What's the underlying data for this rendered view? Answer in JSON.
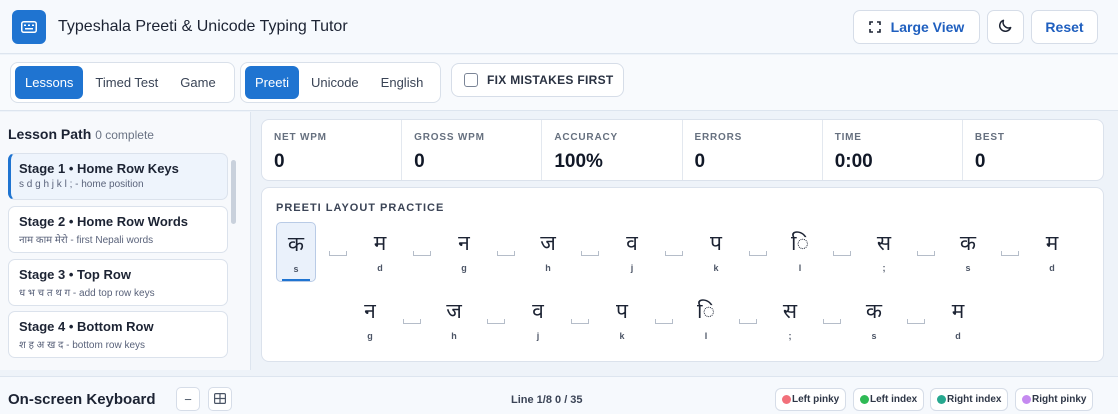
{
  "app": {
    "title": "Typeshala Preeti & Unicode Typing Tutor",
    "accent": "#1f74d1"
  },
  "header": {
    "large_view_label": "Large View",
    "reset_label": "Reset"
  },
  "mode_tabs": [
    {
      "label": "Lessons",
      "active": true
    },
    {
      "label": "Timed Test",
      "active": false
    },
    {
      "label": "Game",
      "active": false
    }
  ],
  "layout_tabs": [
    {
      "label": "Preeti",
      "active": true
    },
    {
      "label": "Unicode",
      "active": false
    },
    {
      "label": "English",
      "active": false
    }
  ],
  "fix_mistakes": {
    "label": "FIX MISTAKES FIRST",
    "checked": false
  },
  "sidebar": {
    "heading": "Lesson Path",
    "progress": "0 complete",
    "stages": [
      {
        "title": "Stage 1 • Home Row Keys",
        "subtitle": "s d g h j k l ; - home position",
        "active": true
      },
      {
        "title": "Stage 2 • Home Row Words",
        "subtitle": "नाम काम मेरो - first Nepali words",
        "active": false
      },
      {
        "title": "Stage 3 • Top Row",
        "subtitle": "ध भ च त थ ग - add top row keys",
        "active": false
      },
      {
        "title": "Stage 4 • Bottom Row",
        "subtitle": "श ह अ ख द - bottom row keys",
        "active": false
      }
    ]
  },
  "stats": [
    {
      "label": "NET WPM",
      "value": "0"
    },
    {
      "label": "GROSS WPM",
      "value": "0"
    },
    {
      "label": "ACCURACY",
      "value": "100%"
    },
    {
      "label": "ERRORS",
      "value": "0"
    },
    {
      "label": "TIME",
      "value": "0:00"
    },
    {
      "label": "BEST",
      "value": "0"
    }
  ],
  "practice": {
    "title": "PREETI LAYOUT PRACTICE",
    "row1": [
      {
        "glyph": "क",
        "key": "s"
      },
      {
        "glyph": "म",
        "key": "d"
      },
      {
        "glyph": "न",
        "key": "g"
      },
      {
        "glyph": "ज",
        "key": "h"
      },
      {
        "glyph": "व",
        "key": "j"
      },
      {
        "glyph": "प",
        "key": "k"
      },
      {
        "glyph": "ि",
        "key": "l"
      },
      {
        "glyph": "स",
        "key": ";"
      },
      {
        "glyph": "क",
        "key": "s"
      },
      {
        "glyph": "म",
        "key": "d"
      }
    ],
    "row2": [
      {
        "glyph": "न",
        "key": "g"
      },
      {
        "glyph": "ज",
        "key": "h"
      },
      {
        "glyph": "व",
        "key": "j"
      },
      {
        "glyph": "प",
        "key": "k"
      },
      {
        "glyph": "ि",
        "key": "l"
      },
      {
        "glyph": "स",
        "key": ";"
      },
      {
        "glyph": "क",
        "key": "s"
      },
      {
        "glyph": "म",
        "key": "d"
      }
    ]
  },
  "keyboard": {
    "title": "On-screen Keyboard",
    "collapse_label": "−",
    "line_info": "Line 1/8 0 / 35",
    "legend": [
      {
        "label": "Left pinky",
        "color": "#f2707a"
      },
      {
        "label": "Left index",
        "color": "#2fba55"
      },
      {
        "label": "Right index",
        "color": "#27a88f"
      },
      {
        "label": "Right pinky",
        "color": "#c58af0"
      }
    ]
  }
}
